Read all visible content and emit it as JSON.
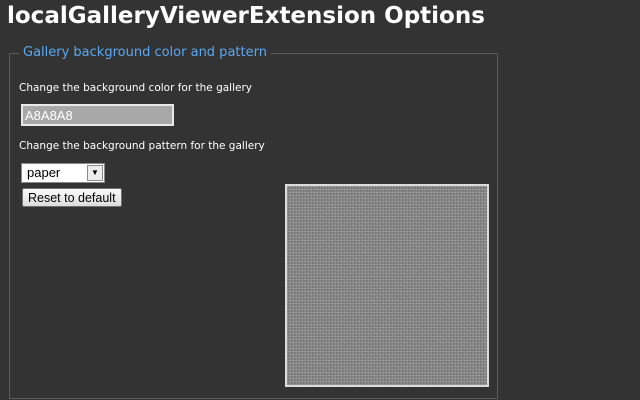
{
  "page": {
    "title": "localGalleryViewerExtension Options"
  },
  "fieldset": {
    "legend": "Gallery background color and pattern",
    "color_label": "Change the background color for the gallery",
    "color_value": "A8A8A8",
    "pattern_label": "Change the background pattern for the gallery",
    "pattern_selected": "paper",
    "reset_label": "Reset to default",
    "preview_pattern": "paper",
    "preview_color": "#A8A8A8"
  },
  "icons": {
    "select_arrow": "chevron-down-icon"
  },
  "colors": {
    "page_background": "#333333",
    "legend_text": "#5aa9f2",
    "title_text": "#ffffff"
  }
}
